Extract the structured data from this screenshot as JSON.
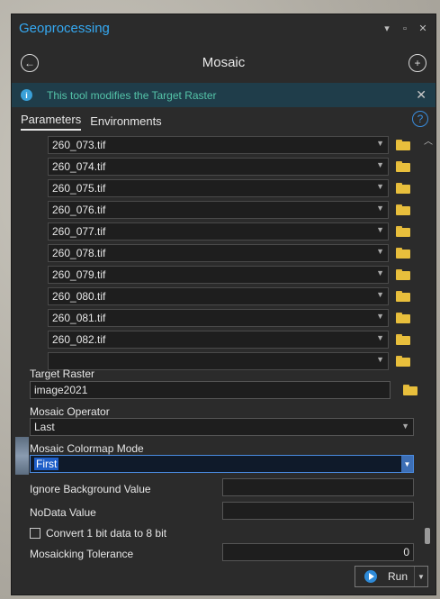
{
  "window": {
    "title": "Geoprocessing",
    "tool_title": "Mosaic"
  },
  "info": {
    "message": "This tool modifies the Target Raster"
  },
  "tabs": [
    {
      "label": "Parameters",
      "active": true
    },
    {
      "label": "Environments",
      "active": false
    }
  ],
  "input_rasters": [
    "260_073.tif",
    "260_074.tif",
    "260_075.tif",
    "260_076.tif",
    "260_077.tif",
    "260_078.tif",
    "260_079.tif",
    "260_080.tif",
    "260_081.tif",
    "260_082.tif",
    ""
  ],
  "target_raster": {
    "label": "Target Raster",
    "value": "image2021"
  },
  "mosaic_operator": {
    "label": "Mosaic Operator",
    "value": "Last"
  },
  "mosaic_colormap_mode": {
    "label": "Mosaic Colormap Mode",
    "value": "First"
  },
  "ignore_background": {
    "label": "Ignore Background Value",
    "value": ""
  },
  "nodata": {
    "label": "NoData Value",
    "value": ""
  },
  "convert_1bit": {
    "label": "Convert 1 bit data to 8 bit",
    "checked": false
  },
  "mosaicking_tolerance": {
    "label": "Mosaicking Tolerance",
    "value": "0"
  },
  "run_button": {
    "label": "Run"
  },
  "colors": {
    "accent": "#35a9f2",
    "info_bg": "#1f3d4a",
    "info_text": "#54c4a9",
    "panel_bg": "#2b2b2b",
    "folder": "#e8bf3c"
  }
}
